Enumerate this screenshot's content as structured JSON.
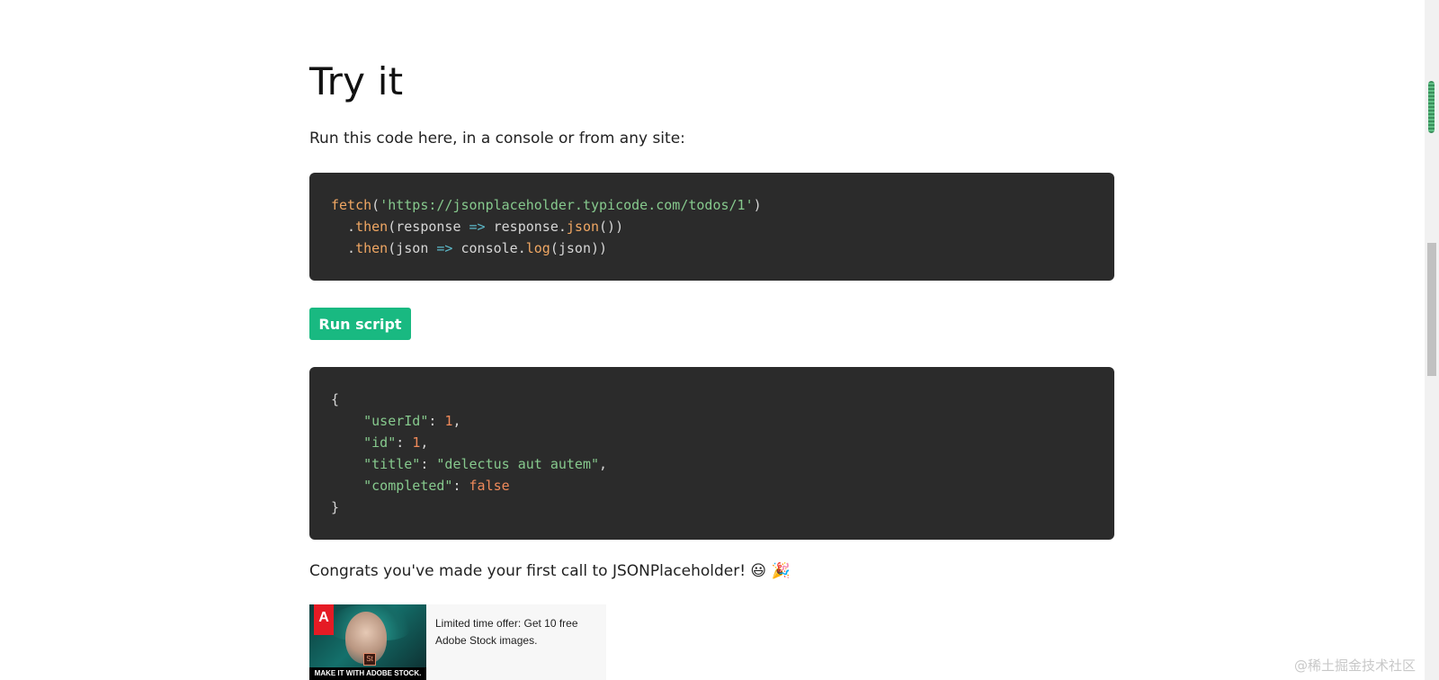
{
  "page": {
    "title": "Try it",
    "intro": "Run this code here, in a console or from any site:",
    "congrats": "Congrats you've made your first call to JSONPlaceholder! 😃 🎉"
  },
  "request_code": {
    "line1_fn": "fetch",
    "line1_paren_open": "(",
    "line1_url": "'https://jsonplaceholder.typicode.com/todos/1'",
    "line1_paren_close": ")",
    "line2_dot": "  .",
    "line2_then": "then",
    "line2_a": "(response ",
    "line2_arrow": "=>",
    "line2_b": " response.",
    "line2_json": "json",
    "line2_c": "())",
    "line3_dot": "  .",
    "line3_then": "then",
    "line3_a": "(json ",
    "line3_arrow": "=>",
    "line3_b": " console.",
    "line3_log": "log",
    "line3_c": "(json))"
  },
  "run_button": {
    "label": "Run script"
  },
  "response": {
    "open_brace": "{",
    "close_brace": "}",
    "fields": [
      {
        "key": "\"userId\"",
        "value": "1",
        "kind": "num",
        "comma": ","
      },
      {
        "key": "\"id\"",
        "value": "1",
        "kind": "num",
        "comma": ","
      },
      {
        "key": "\"title\"",
        "value": "\"delectus aut autem\"",
        "kind": "str",
        "comma": ","
      },
      {
        "key": "\"completed\"",
        "value": "false",
        "kind": "bool",
        "comma": ""
      }
    ]
  },
  "ad": {
    "text": "Limited time offer: Get 10 free Adobe Stock images.",
    "image_caption": "MAKE IT WITH ADOBE STOCK.",
    "logo_text": "A",
    "logo_label": "Adobe",
    "st_badge": "St"
  },
  "watermark": "@稀土掘金技术社区",
  "colors": {
    "button_bg": "#19b981",
    "code_bg": "#2b2b2b",
    "code_fn": "#f0a763",
    "code_str": "#86c98d",
    "code_op": "#5cb8c8",
    "code_num": "#f08a5a"
  },
  "icons": [
    "scrollbar-thumb",
    "adobe-logo-icon"
  ]
}
